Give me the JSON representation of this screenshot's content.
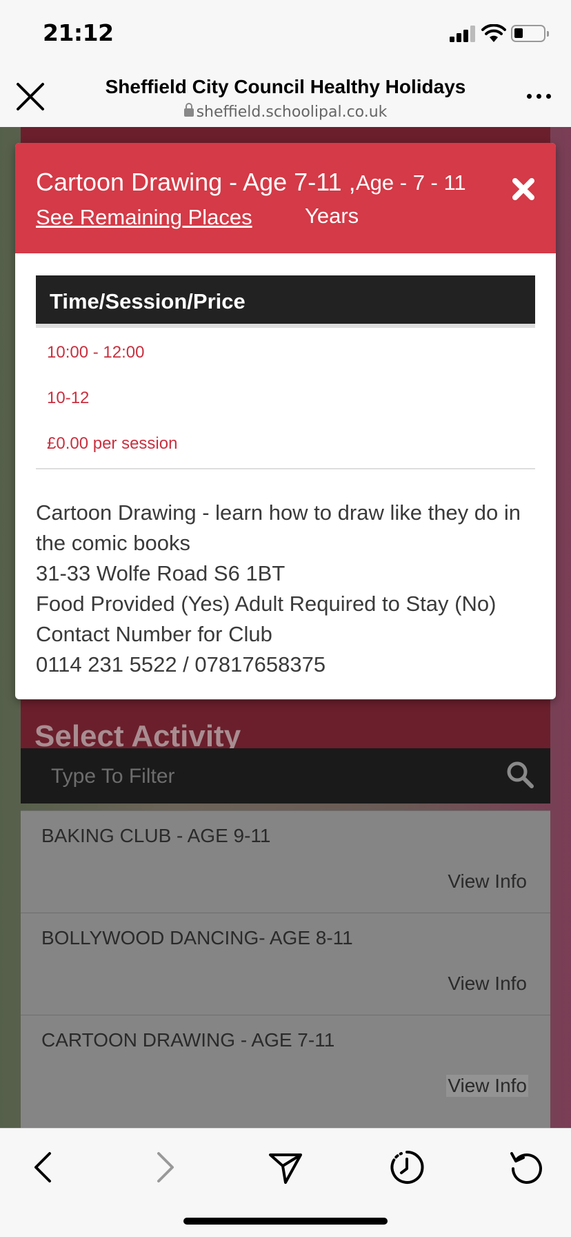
{
  "status_bar": {
    "time": "21:12"
  },
  "browser": {
    "title": "Sheffield City Council Healthy Holidays",
    "url": "sheffield.schoolipal.co.uk"
  },
  "background_page": {
    "select_activity_heading": "Select Activity",
    "filter_placeholder": "Type To Filter",
    "activities": [
      {
        "name": "BAKING CLUB - AGE 9-11",
        "action": "View Info"
      },
      {
        "name": "BOLLYWOOD DANCING- AGE 8-11",
        "action": "View Info"
      },
      {
        "name": "CARTOON DRAWING - AGE 7-11",
        "action": "View Info"
      }
    ]
  },
  "modal": {
    "title": "Cartoon Drawing - Age 7-11 ,",
    "age": "Age - 7 - 11",
    "age_unit": "Years",
    "remaining_link": "See Remaining Places",
    "table_header": "Time/Session/Price",
    "time": "10:00 - 12:00",
    "session": "10-12",
    "price": "£0.00 per session",
    "description": [
      "Cartoon Drawing - learn how to draw like they do in",
      "the comic books",
      "31-33 Wolfe Road S6 1BT",
      "Food Provided (Yes) Adult Required to Stay (No)",
      "Contact Number for Club",
      "0114 231 5522 / 07817658375"
    ]
  },
  "colors": {
    "header_red": "#d43a47",
    "link_red": "#c9303f",
    "dark": "#222222"
  }
}
